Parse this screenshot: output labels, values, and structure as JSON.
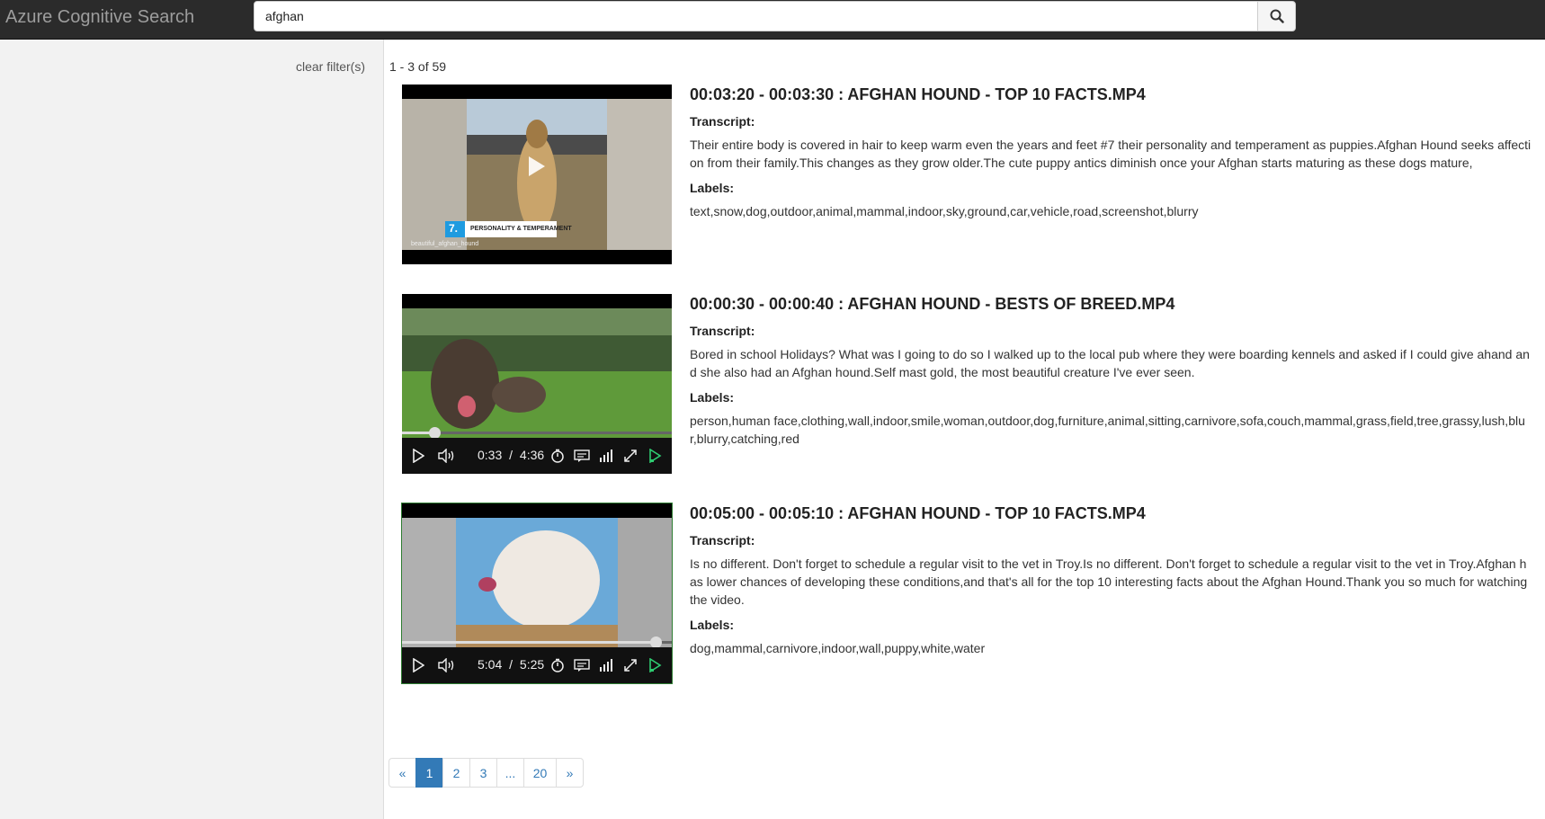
{
  "navbar": {
    "brand": "Azure Cognitive Search"
  },
  "search": {
    "value": "afghan",
    "placeholder": ""
  },
  "sidebar": {
    "clear_filters": "clear filter(s)"
  },
  "results_count": "1 - 3 of 59",
  "labels": {
    "transcript": "Transcript:",
    "labels": "Labels:"
  },
  "results": [
    {
      "title": "00:03:20 - 00:03:30 : AFGHAN HOUND - TOP 10 FACTS.MP4",
      "transcript": "Their entire body is covered in hair to keep warm even the years and feet #7 their personality and temperament as puppies.Afghan Hound seeks affection from their family.This changes as they grow older.The cute puppy antics diminish once your Afghan starts maturing as these dogs mature,",
      "labels": "text,snow,dog,outdoor,animal,mammal,indoor,sky,ground,car,vehicle,road,screenshot,blurry",
      "thumb_caption_number": "7.",
      "thumb_caption_text": "PERSONALITY & TEMPERAMENT",
      "thumb_watermark": "beautiful_afghan_hound"
    },
    {
      "title": "00:00:30 - 00:00:40 : AFGHAN HOUND - BESTS OF BREED.MP4",
      "transcript": "Bored in school Holidays? What was I going to do so I walked up to the local pub where they were boarding kennels and asked if I could give ahand and she also had an Afghan hound.Self mast gold, the most beautiful creature I've ever seen.",
      "labels": "person,human face,clothing,wall,indoor,smile,woman,outdoor,dog,furniture,animal,sitting,carnivore,sofa,couch,mammal,grass,field,tree,grassy,lush,blur,blurry,catching,red",
      "player": {
        "current": "0:33",
        "separator": "/",
        "duration": "4:36",
        "progress": 0.12
      }
    },
    {
      "title": "00:05:00 - 00:05:10 : AFGHAN HOUND - TOP 10 FACTS.MP4",
      "transcript": "Is no different. Don't forget to schedule a regular visit to the vet in Troy.Is no different. Don't forget to schedule a regular visit to the vet in Troy.Afghan has lower chances of developing these conditions,and that's all for the top 10 interesting facts about the Afghan Hound.Thank you so much for watching the video.",
      "labels": "dog,mammal,carnivore,indoor,wall,puppy,white,water",
      "player": {
        "current": "5:04",
        "separator": "/",
        "duration": "5:25",
        "progress": 0.97
      }
    }
  ],
  "pagination": [
    {
      "label": "«",
      "name": "page-prev",
      "active": false
    },
    {
      "label": "1",
      "name": "page-1",
      "active": true
    },
    {
      "label": "2",
      "name": "page-2",
      "active": false
    },
    {
      "label": "3",
      "name": "page-3",
      "active": false
    },
    {
      "label": "...",
      "name": "page-ellipsis",
      "active": false
    },
    {
      "label": "20",
      "name": "page-20",
      "active": false
    },
    {
      "label": "»",
      "name": "page-next",
      "active": false
    }
  ],
  "colors": {
    "accent": "#337ab7",
    "navbar": "#2b2b2b",
    "sidebar": "#f2f2f2",
    "play_green": "#2ecc71"
  }
}
